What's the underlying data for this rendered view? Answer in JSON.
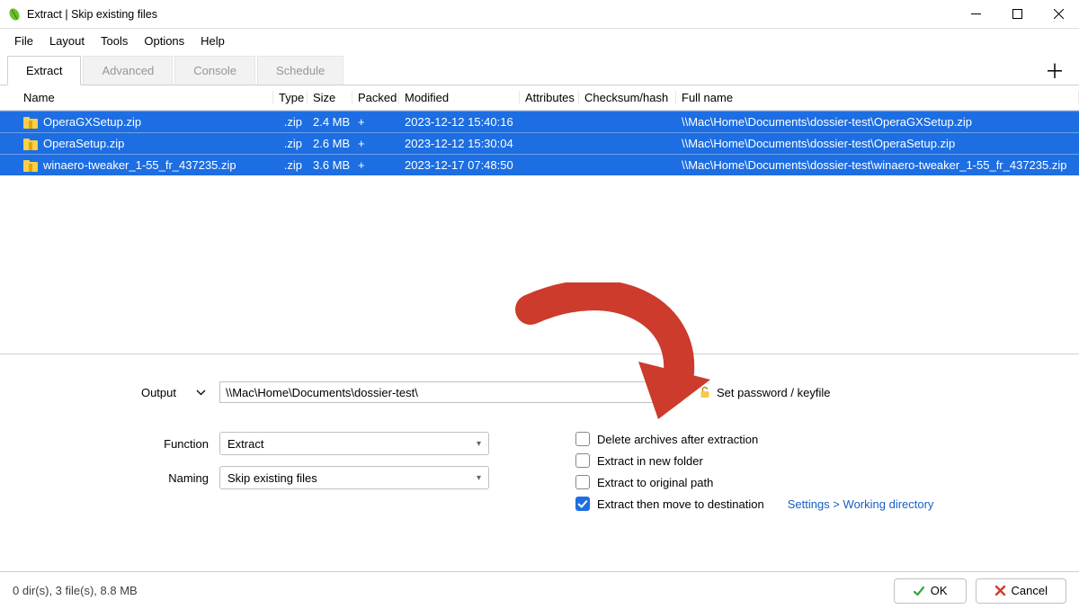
{
  "window": {
    "title": "Extract | Skip existing files"
  },
  "menubar": [
    "File",
    "Layout",
    "Tools",
    "Options",
    "Help"
  ],
  "tabs": [
    "Extract",
    "Advanced",
    "Console",
    "Schedule"
  ],
  "active_tab": 0,
  "columns": {
    "name": "Name",
    "type": "Type",
    "size": "Size",
    "packed": "Packed",
    "modified": "Modified",
    "attributes": "Attributes",
    "hash": "Checksum/hash",
    "full": "Full name"
  },
  "rows": [
    {
      "name": "OperaGXSetup.zip",
      "type": ".zip",
      "size": "2.4 MB",
      "packed": "+",
      "modified": "2023-12-12 15:40:16",
      "full": "\\\\Mac\\Home\\Documents\\dossier-test\\OperaGXSetup.zip"
    },
    {
      "name": "OperaSetup.zip",
      "type": ".zip",
      "size": "2.6 MB",
      "packed": "+",
      "modified": "2023-12-12 15:30:04",
      "full": "\\\\Mac\\Home\\Documents\\dossier-test\\OperaSetup.zip"
    },
    {
      "name": "winaero-tweaker_1-55_fr_437235.zip",
      "type": ".zip",
      "size": "3.6 MB",
      "packed": "+",
      "modified": "2023-12-17 07:48:50",
      "full": "\\\\Mac\\Home\\Documents\\dossier-test\\winaero-tweaker_1-55_fr_437235.zip"
    }
  ],
  "form": {
    "output_label": "Output",
    "output_value": "\\\\Mac\\Home\\Documents\\dossier-test\\",
    "browse": "...",
    "password": "Set password / keyfile",
    "function_label": "Function",
    "function_value": "Extract",
    "naming_label": "Naming",
    "naming_value": "Skip existing files"
  },
  "checks": {
    "delete": "Delete archives after extraction",
    "newfolder": "Extract in new folder",
    "original": "Extract to original path",
    "move": "Extract then move to destination"
  },
  "settings_link_a": "Settings >",
  "settings_link_b": "Working directory",
  "status": "0 dir(s), 3 file(s), 8.8 MB",
  "buttons": {
    "ok": "OK",
    "cancel": "Cancel"
  }
}
